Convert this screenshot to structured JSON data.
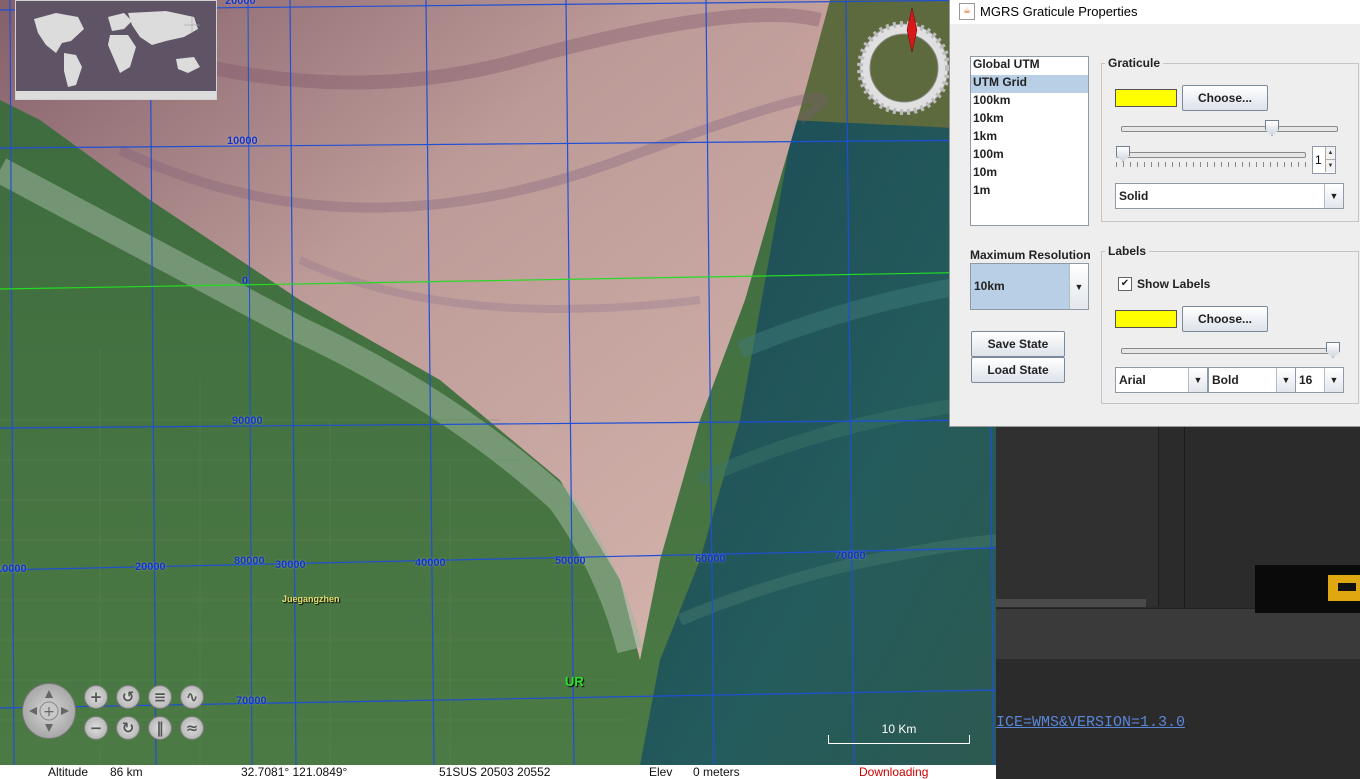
{
  "map": {
    "grid_labels": {
      "n20000": "20000",
      "n10000": "10000",
      "n0": "0",
      "n90000": "90000",
      "n80000": "80000",
      "n70000": "70000",
      "e10000": "10000",
      "e20000": "20000",
      "e30000": "30000",
      "e40000": "40000",
      "e50000": "50000",
      "e60000": "60000",
      "e70000": "70000"
    },
    "place_label": "Juegangzhen",
    "zone_label": "UR",
    "scale_label": "10 Km",
    "line_color": "#1e4fd8",
    "equator_color": "#22dd22"
  },
  "nav": {
    "icons": [
      "pan-icon",
      "zoom-in-icon",
      "zoom-out-icon",
      "rotate-left-icon",
      "rotate-right-icon",
      "tilt-up-icon",
      "tilt-down-icon",
      "exaggerate-up-icon",
      "exaggerate-down-icon"
    ]
  },
  "status": {
    "altitude_label": "Altitude",
    "altitude_value": "86 km",
    "coords": "32.7081° 121.0849°",
    "mgrs": "51SUS 20503 20552",
    "elev_label": "Elev",
    "elev_value": "0 meters",
    "state": "Downloading",
    "state_color": "#cc0000"
  },
  "background": {
    "url_fragment": "ICE=WMS&VERSION=1.3.0"
  },
  "dialog": {
    "title": "MGRS Graticule Properties",
    "layers": [
      "Global UTM",
      "UTM Grid",
      "100km",
      "10km",
      "1km",
      "100m",
      "10m",
      "1m"
    ],
    "selected_layer": "UTM Grid",
    "graticule": {
      "legend": "Graticule",
      "choose_label": "Choose...",
      "swatch_color": "#ffff00",
      "opacity_fraction": 0.7,
      "width_fraction": 0.0,
      "width_value": "1",
      "line_style": "Solid"
    },
    "max_resolution": {
      "label": "Maximum Resolution",
      "value": "10km"
    },
    "save_label": "Save State",
    "load_label": "Load State",
    "labels": {
      "legend": "Labels",
      "show_labels": "Show Labels",
      "show_checked": "✔",
      "choose_label": "Choose...",
      "swatch_color": "#ffff00",
      "opacity_fraction": 1.0,
      "font": "Arial",
      "style": "Bold",
      "size": "16"
    }
  }
}
